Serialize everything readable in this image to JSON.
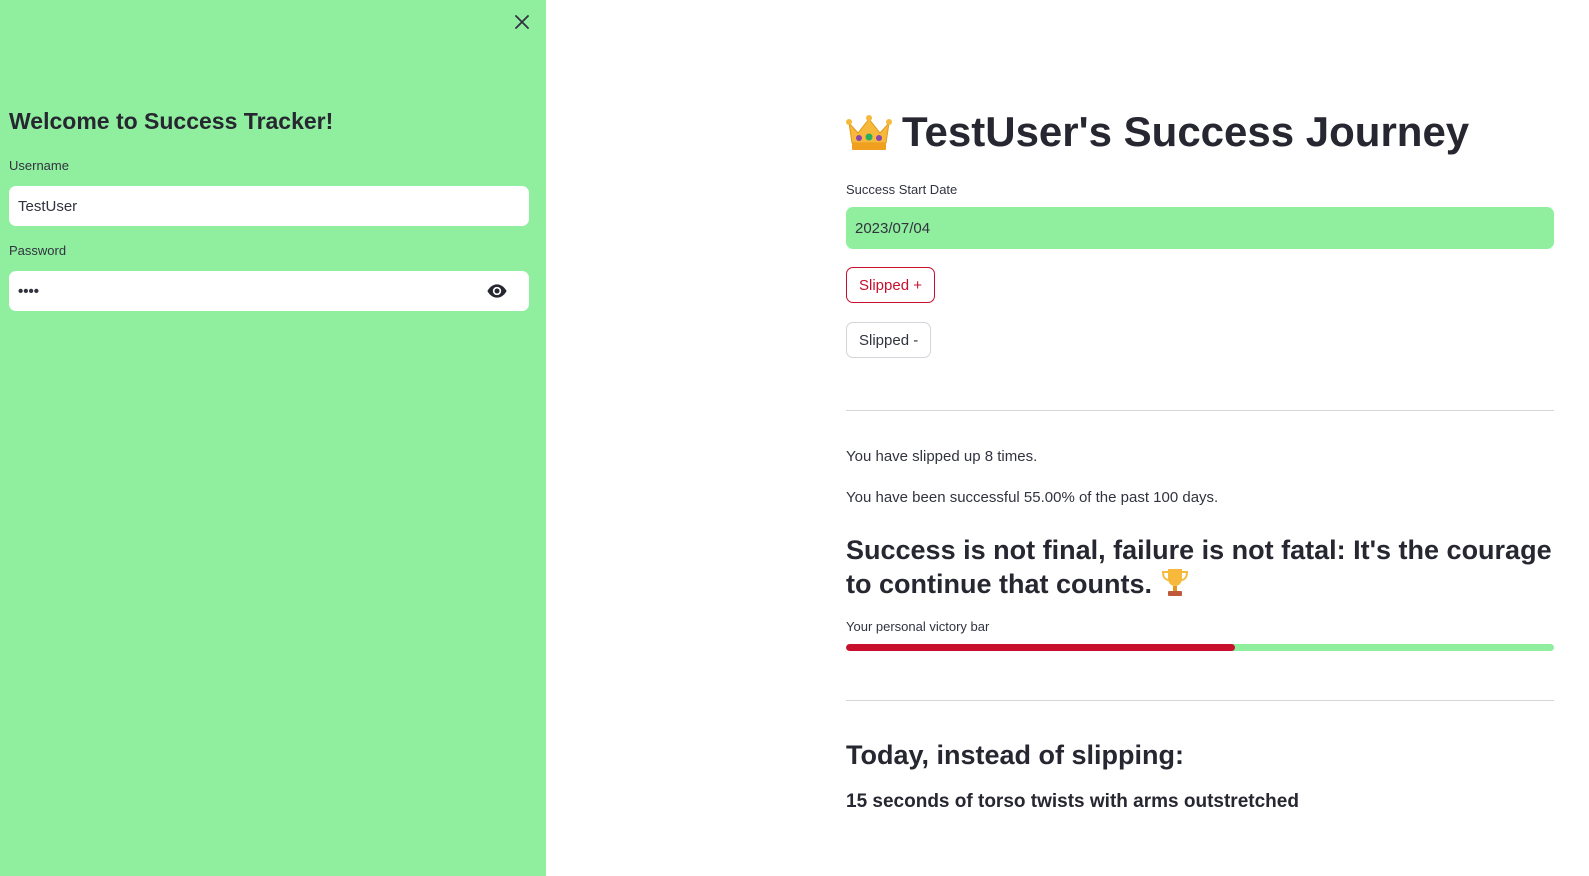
{
  "sidebar": {
    "title": "Welcome to Success Tracker!",
    "username_label": "Username",
    "username_value": "TestUser",
    "password_label": "Password",
    "password_value": "••••",
    "background_color": "#90ee9f",
    "icons": [
      "close-icon",
      "eye-icon"
    ]
  },
  "main": {
    "title_icon": "crown-icon",
    "title": "TestUser's Success Journey",
    "date_label": "Success Start Date",
    "date_value": "2023/07/04",
    "buttons": {
      "slipped_plus": "Slipped +",
      "slipped_minus": "Slipped -"
    },
    "slipped_text": "You have slipped up 8 times.",
    "success_text": "You have been successful 55.00% of the past 100 days.",
    "quote": "Success is not final, failure is not fatal: It's the courage to continue that counts.",
    "quote_icon": "trophy-icon",
    "progress": {
      "label": "Your personal victory bar",
      "value_percent": 55,
      "fill_color": "#c8102e",
      "track_color": "#90ee9f"
    },
    "alternative_heading": "Today, instead of slipping:",
    "alternative_activity": "15 seconds of torso twists with arms outstretched"
  }
}
